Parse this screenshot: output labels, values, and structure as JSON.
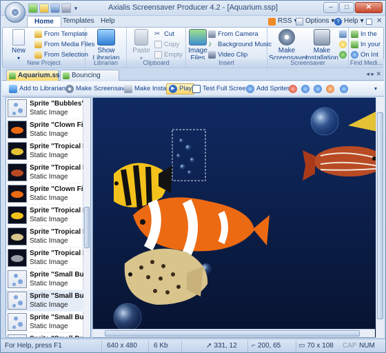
{
  "window": {
    "title": "Axialis Screensaver Producer 4.2 - [Aquarium.ssp]",
    "minimize": "–",
    "maximize": "□",
    "close": "✕"
  },
  "ribbon_tabs": {
    "home": "Home",
    "templates": "Templates",
    "help": "Help",
    "rss": "RSS",
    "options": "Options",
    "help_menu": "Help"
  },
  "groups": {
    "new_project": {
      "label": "New Project",
      "new": "New",
      "from_template": "From Template",
      "from_media": "From Media Files",
      "from_selection": "From Selection"
    },
    "librarian": {
      "label": "Librarian",
      "show_line1": "Show",
      "show_line2": "Librarian"
    },
    "clipboard": {
      "label": "Clipboard",
      "paste": "Paste",
      "cut": "Cut",
      "copy": "Copy",
      "empty": "Empty"
    },
    "insert": {
      "label": "Insert",
      "image_line1": "Image",
      "image_line2": "Files",
      "from_camera": "From Camera",
      "bg_music": "Background Music",
      "video_clip": "Video Clip"
    },
    "screensaver": {
      "label": "Screensaver",
      "make_line1": "Make",
      "make_line2": "Screensaver",
      "install_line1": "Make",
      "install_line2": "Installation"
    },
    "find_media": {
      "label": "Find Medi...",
      "in_the": "In the",
      "in_your": "In your",
      "on_int": "On Int"
    }
  },
  "doc_tabs": [
    "Aquarium.ssp",
    "Bouncing Ball.ssp"
  ],
  "toolbar": {
    "add_librarian": "Add to Librarian",
    "make_screensaver": "Make Screensaver",
    "make_install": "Make Install",
    "play": "Play",
    "test_full": "Test Full Screen",
    "add_sprites": "Add Sprites"
  },
  "sprites": [
    {
      "name": "Sprite \"Bubbles\"",
      "type": "Static Image"
    },
    {
      "name": "Sprite \"Clown Fish\"",
      "type": "Static Image"
    },
    {
      "name": "Sprite \"Tropical Fish\"",
      "type": "Static Image"
    },
    {
      "name": "Sprite \"Tropical Fish\"",
      "type": "Static Image"
    },
    {
      "name": "Sprite \"Clown Fish\"",
      "type": "Static Image"
    },
    {
      "name": "Sprite \"Tropical Fish\"",
      "type": "Static Image"
    },
    {
      "name": "Sprite \"Tropical Fish\"",
      "type": "Static Image"
    },
    {
      "name": "Sprite \"Tropical Fish\"",
      "type": "Static Image"
    },
    {
      "name": "Sprite \"Small Bubbles\"",
      "type": "Static Image"
    },
    {
      "name": "Sprite \"Small Bubbles\"",
      "type": "Static Image"
    },
    {
      "name": "Sprite \"Small Bubbles\"",
      "type": "Static Image"
    },
    {
      "name": "Sprite \"Small Bubbles\"",
      "type": ""
    }
  ],
  "status": {
    "help": "For Help, press F1",
    "resolution": "640 x 480",
    "size": "6 Kb",
    "cursor": "331, 12",
    "position": "200, 65",
    "dimensions": "70 x 108",
    "cap": "CAP",
    "num": "NUM"
  },
  "colors": {
    "canvas_bg": "#132452",
    "accent": "#15428b",
    "active_tab": "#ffd86a"
  }
}
